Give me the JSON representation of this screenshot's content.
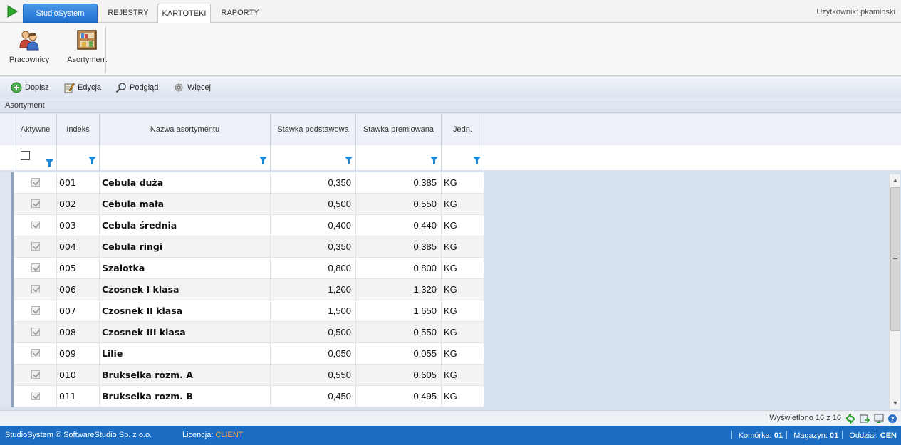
{
  "tabs": {
    "studio": "StudioSystem",
    "rejestry": "REJESTRY",
    "kartoteki": "KARTOTEKI",
    "raporty": "RAPORTY"
  },
  "user_label": "Użytkownik: pkaminski",
  "ribbon": {
    "pracownicy": "Pracownicy",
    "asortyment": "Asortyment"
  },
  "toolbar": {
    "dopisz": "Dopisz",
    "edycja": "Edycja",
    "podglad": "Podgląd",
    "wiecej": "Więcej"
  },
  "section_title": "Asortyment",
  "columns": {
    "aktywne": "Aktywne",
    "indeks": "Indeks",
    "nazwa": "Nazwa asortymentu",
    "stawka_podstawowa": "Stawka podstawowa",
    "stawka_premiowana": "Stawka premiowana",
    "jedn": "Jedn."
  },
  "rows": [
    {
      "aktywne": true,
      "indeks": "001",
      "nazwa": "Cebula duża",
      "podstawowa": "0,350",
      "premiowana": "0,385",
      "jedn": "KG"
    },
    {
      "aktywne": true,
      "indeks": "002",
      "nazwa": "Cebula mała",
      "podstawowa": "0,500",
      "premiowana": "0,550",
      "jedn": "KG"
    },
    {
      "aktywne": true,
      "indeks": "003",
      "nazwa": "Cebula średnia",
      "podstawowa": "0,400",
      "premiowana": "0,440",
      "jedn": "KG"
    },
    {
      "aktywne": true,
      "indeks": "004",
      "nazwa": "Cebula ringi",
      "podstawowa": "0,350",
      "premiowana": "0,385",
      "jedn": "KG"
    },
    {
      "aktywne": true,
      "indeks": "005",
      "nazwa": "Szalotka",
      "podstawowa": "0,800",
      "premiowana": "0,800",
      "jedn": "KG"
    },
    {
      "aktywne": true,
      "indeks": "006",
      "nazwa": "Czosnek I klasa",
      "podstawowa": "1,200",
      "premiowana": "1,320",
      "jedn": "KG"
    },
    {
      "aktywne": true,
      "indeks": "007",
      "nazwa": "Czosnek II klasa",
      "podstawowa": "1,500",
      "premiowana": "1,650",
      "jedn": "KG"
    },
    {
      "aktywne": true,
      "indeks": "008",
      "nazwa": "Czosnek III klasa",
      "podstawowa": "0,500",
      "premiowana": "0,550",
      "jedn": "KG"
    },
    {
      "aktywne": true,
      "indeks": "009",
      "nazwa": "Lilie",
      "podstawowa": "0,050",
      "premiowana": "0,055",
      "jedn": "KG"
    },
    {
      "aktywne": true,
      "indeks": "010",
      "nazwa": "Brukselka rozm. A",
      "podstawowa": "0,550",
      "premiowana": "0,605",
      "jedn": "KG"
    },
    {
      "aktywne": true,
      "indeks": "011",
      "nazwa": "Brukselka rozm. B",
      "podstawowa": "0,450",
      "premiowana": "0,495",
      "jedn": "KG"
    }
  ],
  "displayed": "Wyświetlono 16 z 16",
  "statusbar": {
    "copyright": "StudioSystem © SoftwareStudio Sp. z o.o.",
    "licencja_label": "Licencja:",
    "licencja_value": "CLIENT",
    "komorka_label": "Komórka:",
    "komorka_value": "01",
    "magazyn_label": "Magazyn:",
    "magazyn_value": "01",
    "oddzial_label": "Oddział:",
    "oddzial_value": "CEN"
  },
  "icons": {
    "play": "play-icon",
    "pracownicy": "users-icon",
    "asortyment": "shelf-icon",
    "dopisz": "plus-circle-icon",
    "edycja": "edit-icon",
    "podglad": "magnifier-icon",
    "wiecej": "gear-icon",
    "filter": "filter-funnel-icon"
  },
  "colors": {
    "accent": "#1f6fcf",
    "statusbar": "#1a6dc2",
    "licence": "#ffa64d"
  }
}
